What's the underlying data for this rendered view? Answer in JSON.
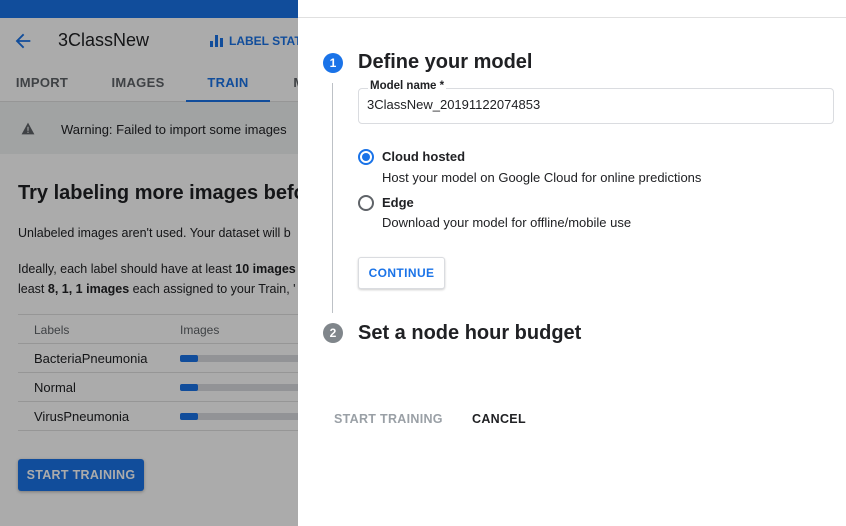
{
  "header": {
    "dataset_name": "3ClassNew",
    "label_stats": "LABEL STATS"
  },
  "tabs": [
    {
      "label": "IMPORT"
    },
    {
      "label": "IMAGES"
    },
    {
      "label": "TRAIN",
      "active": true
    },
    {
      "label": "M"
    }
  ],
  "warning": {
    "text": "Warning: Failed to import some images"
  },
  "background": {
    "heading": "Try labeling more images before",
    "paragraph1": "Unlabeled images aren't used. Your dataset will b",
    "paragraph2_prefix": "Ideally, each label should have at least ",
    "paragraph2_bold": "10 images",
    "paragraph3_prefix": "least ",
    "paragraph3_bold": "8, 1, 1 images",
    "paragraph3_suffix": " each assigned to your Train, '",
    "table": {
      "columns": [
        "Labels",
        "Images"
      ],
      "rows": [
        {
          "label": "BacteriaPneumonia",
          "progress": 0.13
        },
        {
          "label": "Normal",
          "progress": 0.13
        },
        {
          "label": "VirusPneumonia",
          "progress": 0.13
        }
      ]
    },
    "start_training": "START TRAINING"
  },
  "panel": {
    "step1": {
      "number": "1",
      "title": "Define your model",
      "model_name_label": "Model name *",
      "model_name_value": "3ClassNew_20191122074853",
      "options": {
        "cloud": {
          "title": "Cloud hosted",
          "description": "Host your model on Google Cloud for online predictions",
          "selected": true
        },
        "edge": {
          "title": "Edge",
          "description": "Download your model for offline/mobile use",
          "selected": false
        }
      },
      "continue": "CONTINUE"
    },
    "step2": {
      "number": "2",
      "title": "Set a node hour budget"
    },
    "actions": {
      "start_training": "START TRAINING",
      "cancel": "CANCEL"
    }
  },
  "colors": {
    "accent": "#1a73e8",
    "disabled_text": "#9aa0a6",
    "scrim": "rgba(0,0,0,0.33)"
  }
}
